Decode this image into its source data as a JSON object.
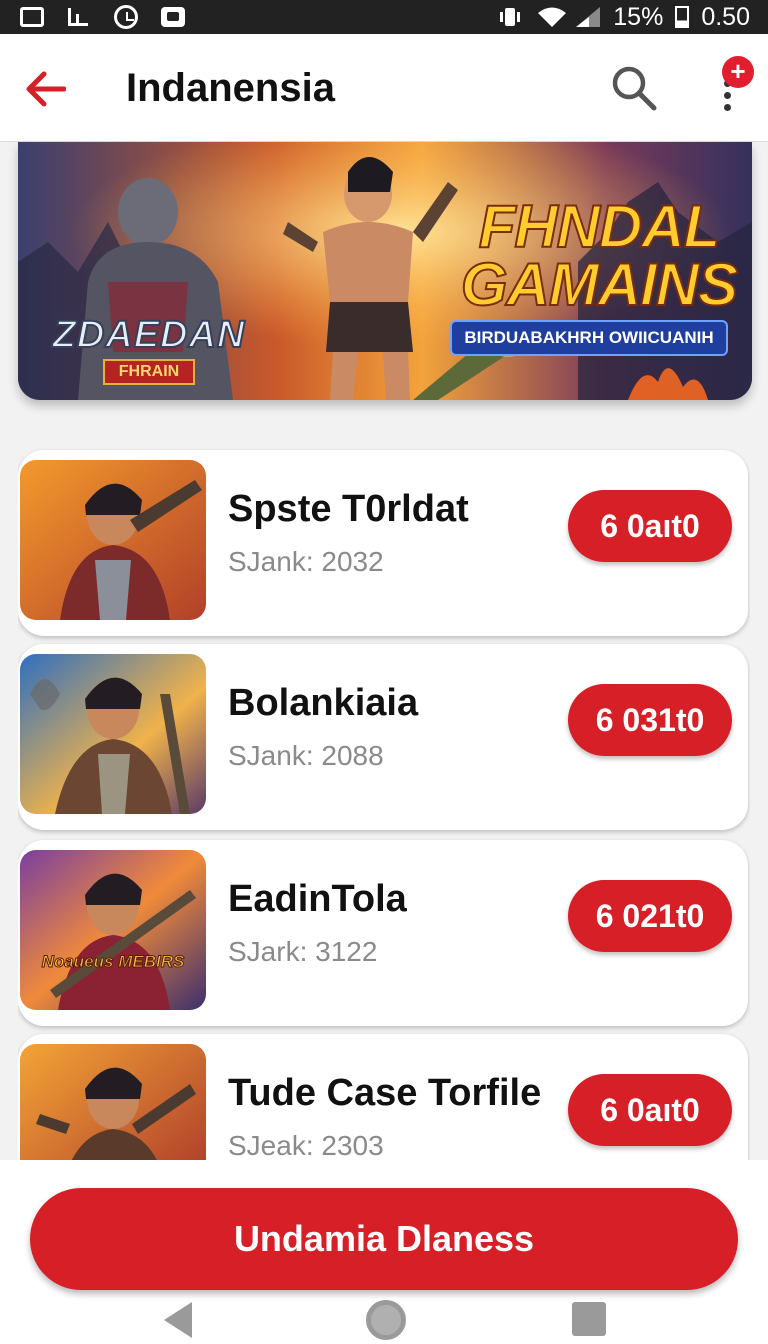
{
  "status_bar": {
    "battery": "15%",
    "time": "0.50",
    "icons": [
      "gallery-icon",
      "signal-bars-icon",
      "alarm-icon",
      "notification-box-icon",
      "vibrate-icon",
      "wifi-icon",
      "cell-signal-icon",
      "battery-icon"
    ]
  },
  "header": {
    "title": "Indanensia",
    "notification_badge": "+",
    "icons": [
      "back-arrow-icon",
      "search-icon",
      "more-vert-icon"
    ],
    "accent_color": "#d71f27"
  },
  "banner": {
    "logo_main": "ZDAEDAN",
    "logo_sub": "FHRAIN",
    "title": "FHNDAL GAMAINS",
    "subtitle": "BIRDUABAKHRH OWIICUANIH"
  },
  "games": [
    {
      "name": "Spste T0rldat",
      "rank": "SJank: 2032",
      "price": "6 0aıt0",
      "thumb_label": ""
    },
    {
      "name": "Bolankiaia",
      "rank": "SJank: 2088",
      "price": "6 031t0",
      "thumb_label": ""
    },
    {
      "name": "EadinTola",
      "rank": "SJark: 3122",
      "price": "6 021t0",
      "thumb_label": "Noaueus MEBIRS"
    },
    {
      "name": "Tude Case Torfile",
      "rank": "SJeak: 2303",
      "price": "6 0aıt0",
      "thumb_label": ""
    }
  ],
  "footer": {
    "primary_button": "Undamia Dlaness"
  },
  "nav": {
    "icons": [
      "nav-back-icon",
      "nav-home-icon",
      "nav-recents-icon"
    ]
  }
}
